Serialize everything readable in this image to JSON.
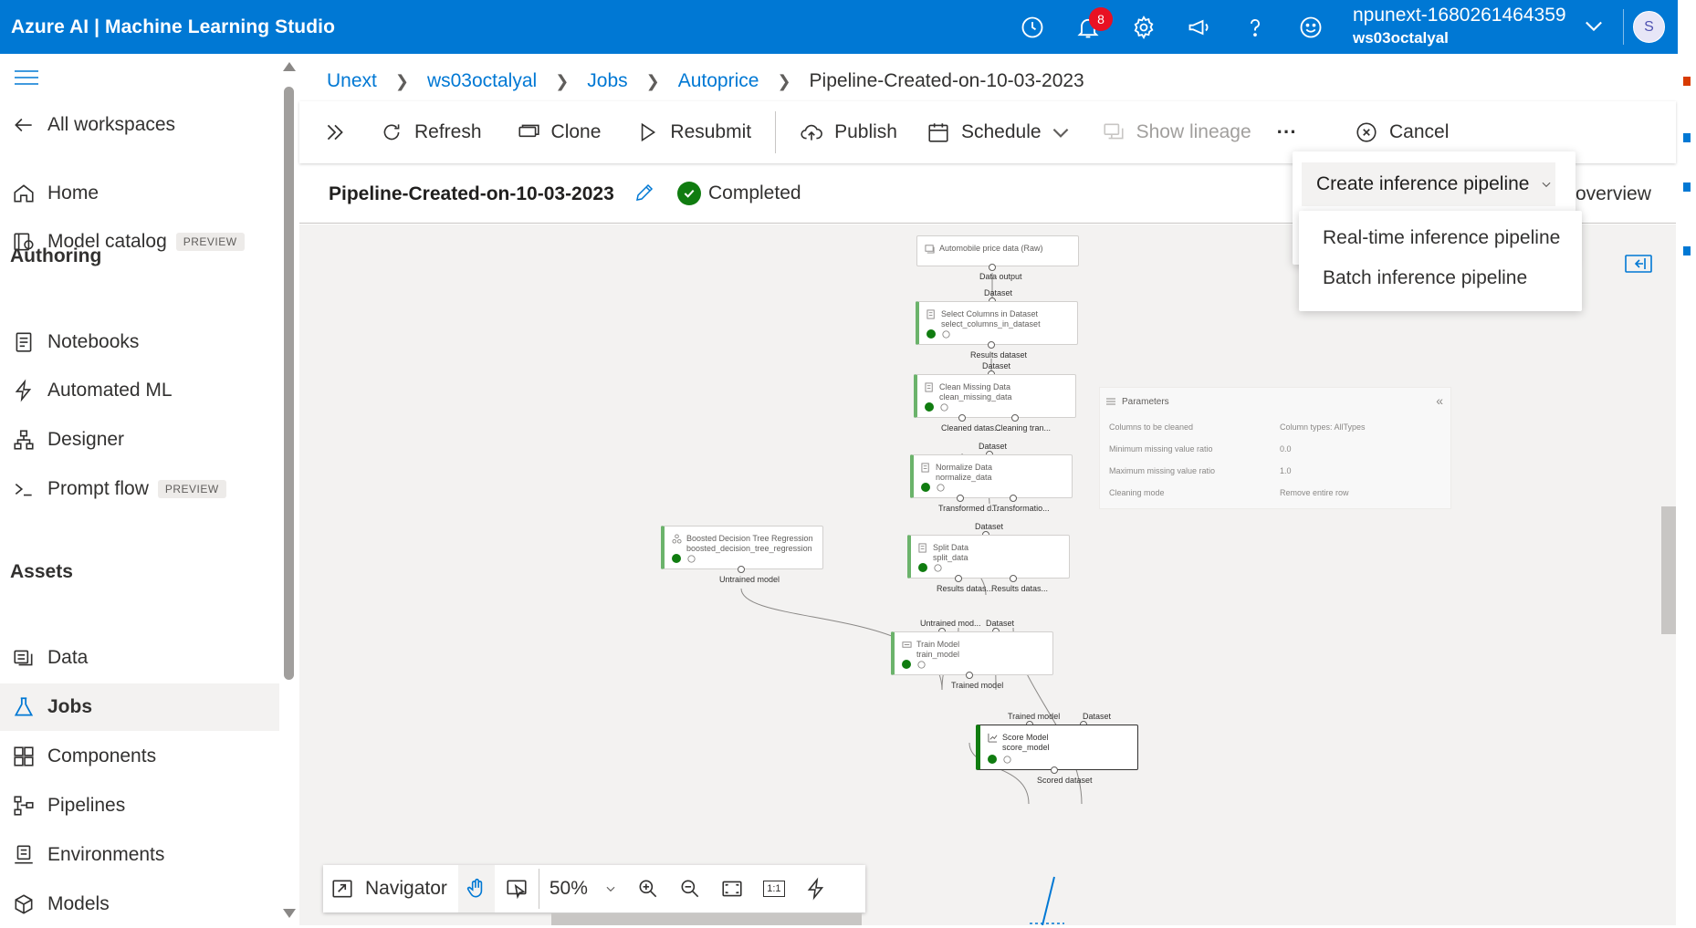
{
  "app": {
    "title": "Azure AI | Machine Learning Studio"
  },
  "topbar": {
    "notification_count": "8",
    "account_name": "npunext-1680261464359",
    "workspace_name": "ws03octalyal",
    "avatar_initial": "S"
  },
  "sidebar": {
    "all_workspaces": "All workspaces",
    "home": "Home",
    "model_catalog": "Model catalog",
    "preview_badge": "PREVIEW",
    "authoring_heading": "Authoring",
    "notebooks": "Notebooks",
    "automated_ml": "Automated ML",
    "designer": "Designer",
    "prompt_flow": "Prompt flow",
    "assets_heading": "Assets",
    "data": "Data",
    "jobs": "Jobs",
    "components": "Components",
    "pipelines": "Pipelines",
    "environments": "Environments",
    "models": "Models"
  },
  "breadcrumb": [
    "Unext",
    "ws03octalyal",
    "Jobs",
    "Autoprice",
    "Pipeline-Created-on-10-03-2023"
  ],
  "toolbar": {
    "refresh": "Refresh",
    "clone": "Clone",
    "resubmit": "Resubmit",
    "publish": "Publish",
    "schedule": "Schedule",
    "show_lineage": "Show lineage",
    "more": "···",
    "cancel": "Cancel"
  },
  "job": {
    "title": "Pipeline-Created-on-10-03-2023",
    "status": "Completed",
    "overview_tab": "overview"
  },
  "dropdown": {
    "trigger": "Create inference pipeline",
    "options": [
      "Real-time inference pipeline",
      "Batch inference pipeline"
    ]
  },
  "pipeline": {
    "nodes": {
      "auto": {
        "title": "Automobile price data (Raw)",
        "out": "Data output"
      },
      "select": {
        "title": "Select Columns in Dataset",
        "sub": "select_columns_in_dataset",
        "in": "Dataset",
        "out": "Results dataset"
      },
      "clean": {
        "title": "Clean Missing Data",
        "sub": "clean_missing_data",
        "in": "Dataset",
        "out1": "Cleaned datas...",
        "out2": "Cleaning tran..."
      },
      "normalize": {
        "title": "Normalize Data",
        "sub": "normalize_data",
        "in": "Dataset",
        "out1": "Transformed d...",
        "out2": "Transformatio..."
      },
      "split": {
        "title": "Split Data",
        "sub": "split_data",
        "in": "Dataset",
        "out1": "Results datas...",
        "out2": "Results datas..."
      },
      "boosted": {
        "title": "Boosted Decision Tree Regression",
        "sub": "boosted_decision_tree_regression",
        "out": "Untrained model"
      },
      "train": {
        "title": "Train Model",
        "sub": "train_model",
        "in1": "Untrained mod...",
        "in2": "Dataset",
        "out": "Trained model"
      },
      "score": {
        "title": "Score Model",
        "sub": "score_model",
        "in1": "Trained model",
        "in2": "Dataset",
        "out": "Scored dataset"
      }
    },
    "parameters": {
      "title": "Parameters",
      "rows": [
        {
          "label": "Columns to be cleaned",
          "value": "Column types: AllTypes"
        },
        {
          "label": "Minimum missing value ratio",
          "value": "0.0"
        },
        {
          "label": "Maximum missing value ratio",
          "value": "1.0"
        },
        {
          "label": "Cleaning mode",
          "value": "Remove entire row"
        }
      ]
    }
  },
  "navigator": {
    "label": "Navigator",
    "zoom": "50%",
    "one_to_one": "1:1"
  },
  "colors": {
    "brand": "#0078d4",
    "success": "#107c10",
    "badge": "#e81123"
  }
}
